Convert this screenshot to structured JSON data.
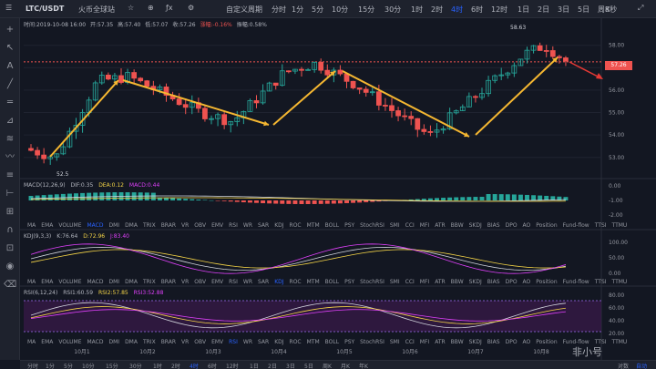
{
  "toolbar": {
    "symbol": "LTC/USDT",
    "exchange": "火币全球站",
    "custom_period": "自定义周期",
    "intervals": [
      "分时",
      "1分",
      "5分",
      "10分",
      "15分",
      "30分",
      "1时",
      "2时",
      "4时",
      "6时",
      "12时",
      "1日",
      "2日",
      "3日",
      "5日",
      "周K"
    ],
    "active_interval": "4时",
    "countdown": "8秒"
  },
  "ohlc": {
    "time": "时间:2019-10-08 16:00",
    "open": "开:57.35",
    "high": "高:57.40",
    "close_low": "低:57.07",
    "close": "收:57.26",
    "change_pct": "涨幅:-0.16%",
    "amplitude": "振幅:0.58%"
  },
  "price_axis": {
    "ticks": [
      "58.00",
      "57.00",
      "56.00",
      "55.00",
      "54.00",
      "53.00"
    ],
    "current": "57.26"
  },
  "annotations": {
    "high_label": "58.63",
    "low_label": "52.5"
  },
  "macd_label": {
    "name": "MACD(12,26,9)",
    "dif": "DIF:0.35",
    "dea": "DEA:0.12",
    "macd": "MACD:0.44"
  },
  "macd_axis": [
    "0.00",
    "-1.00",
    "-2.00"
  ],
  "kdj_label": {
    "name": "KDJ(9,3,3)",
    "k": "K:76.64",
    "d": "D:72.96",
    "j": "J:83.40"
  },
  "kdj_axis": [
    "100.00",
    "50.00",
    "0.00"
  ],
  "rsi_label": {
    "name": "RSI(6,12,24)",
    "r1": "RSI1:60.59",
    "r2": "RSI2:57.85",
    "r3": "RSI3:52.88"
  },
  "rsi_axis": [
    "80.00",
    "60.00",
    "40.00",
    "20.00"
  ],
  "indicator_tabs": [
    "MA",
    "EMA",
    "VOLUME",
    "MACD",
    "DMI",
    "DMA",
    "TRIX",
    "BRAR",
    "VR",
    "OBV",
    "EMV",
    "RSI",
    "WR",
    "SAR",
    "KDJ",
    "ROC",
    "MTM",
    "BOLL",
    "PSY",
    "StochRSI",
    "SMI",
    "CCI",
    "MFI",
    "ATR",
    "BBW",
    "SKDJ",
    "BIAS",
    "DPO",
    "AO",
    "Position",
    "Fund-flow",
    "TTSI",
    "TTMU"
  ],
  "date_ticks": [
    "10月1",
    "10月2",
    "10月3",
    "10月4",
    "10月5",
    "10月6",
    "10月7",
    "10月8"
  ],
  "bottom_intervals": [
    "分时",
    "1分",
    "5分",
    "10分",
    "15分",
    "30分",
    "1时",
    "2时",
    "4时",
    "6时",
    "12时",
    "1日",
    "2日",
    "3日",
    "5日",
    "周K",
    "月K",
    "年K"
  ],
  "bottom_right": [
    "对数",
    "自动"
  ],
  "watermark": "非小号",
  "colors": {
    "up": "#26a69a",
    "down": "#ef5350",
    "arrow": "#f5b731",
    "bg": "#131722"
  }
}
